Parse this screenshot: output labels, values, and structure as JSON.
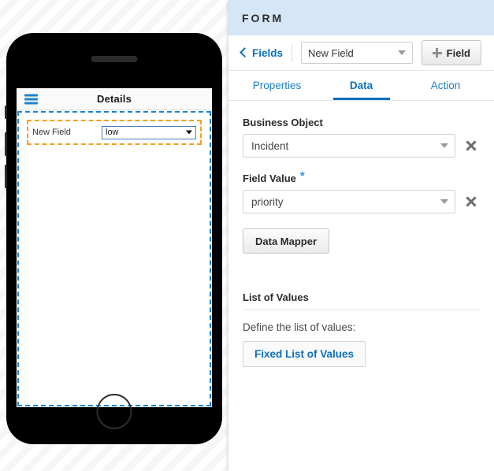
{
  "device_preview": {
    "app_bar": {
      "menu_icon": "hamburger-icon",
      "title": "Details"
    },
    "form_field": {
      "label": "New Field",
      "control_type": "dropdown",
      "value": "low"
    }
  },
  "panel": {
    "header_title": "FORM",
    "toolbar": {
      "back_label": "Fields",
      "field_select_value": "New Field",
      "add_field_label": "Field"
    },
    "tabs": [
      {
        "label": "Properties",
        "active": false
      },
      {
        "label": "Data",
        "active": true
      },
      {
        "label": "Action",
        "active": false
      }
    ],
    "business_object": {
      "label": "Business Object",
      "value": "Incident",
      "required": false
    },
    "field_value": {
      "label": "Field Value",
      "value": "priority",
      "required": true,
      "required_marker": "*"
    },
    "data_mapper_label": "Data Mapper",
    "list_of_values": {
      "title": "List of Values",
      "description": "Define the list of values:",
      "button_label": "Fixed List of Values"
    }
  },
  "colors": {
    "header_blue": "#d5e6f6",
    "accent_blue": "#0a6ebd",
    "selection_blue": "#1a83d6",
    "selection_orange": "#f0a31c",
    "required_star": "#2f93df"
  }
}
